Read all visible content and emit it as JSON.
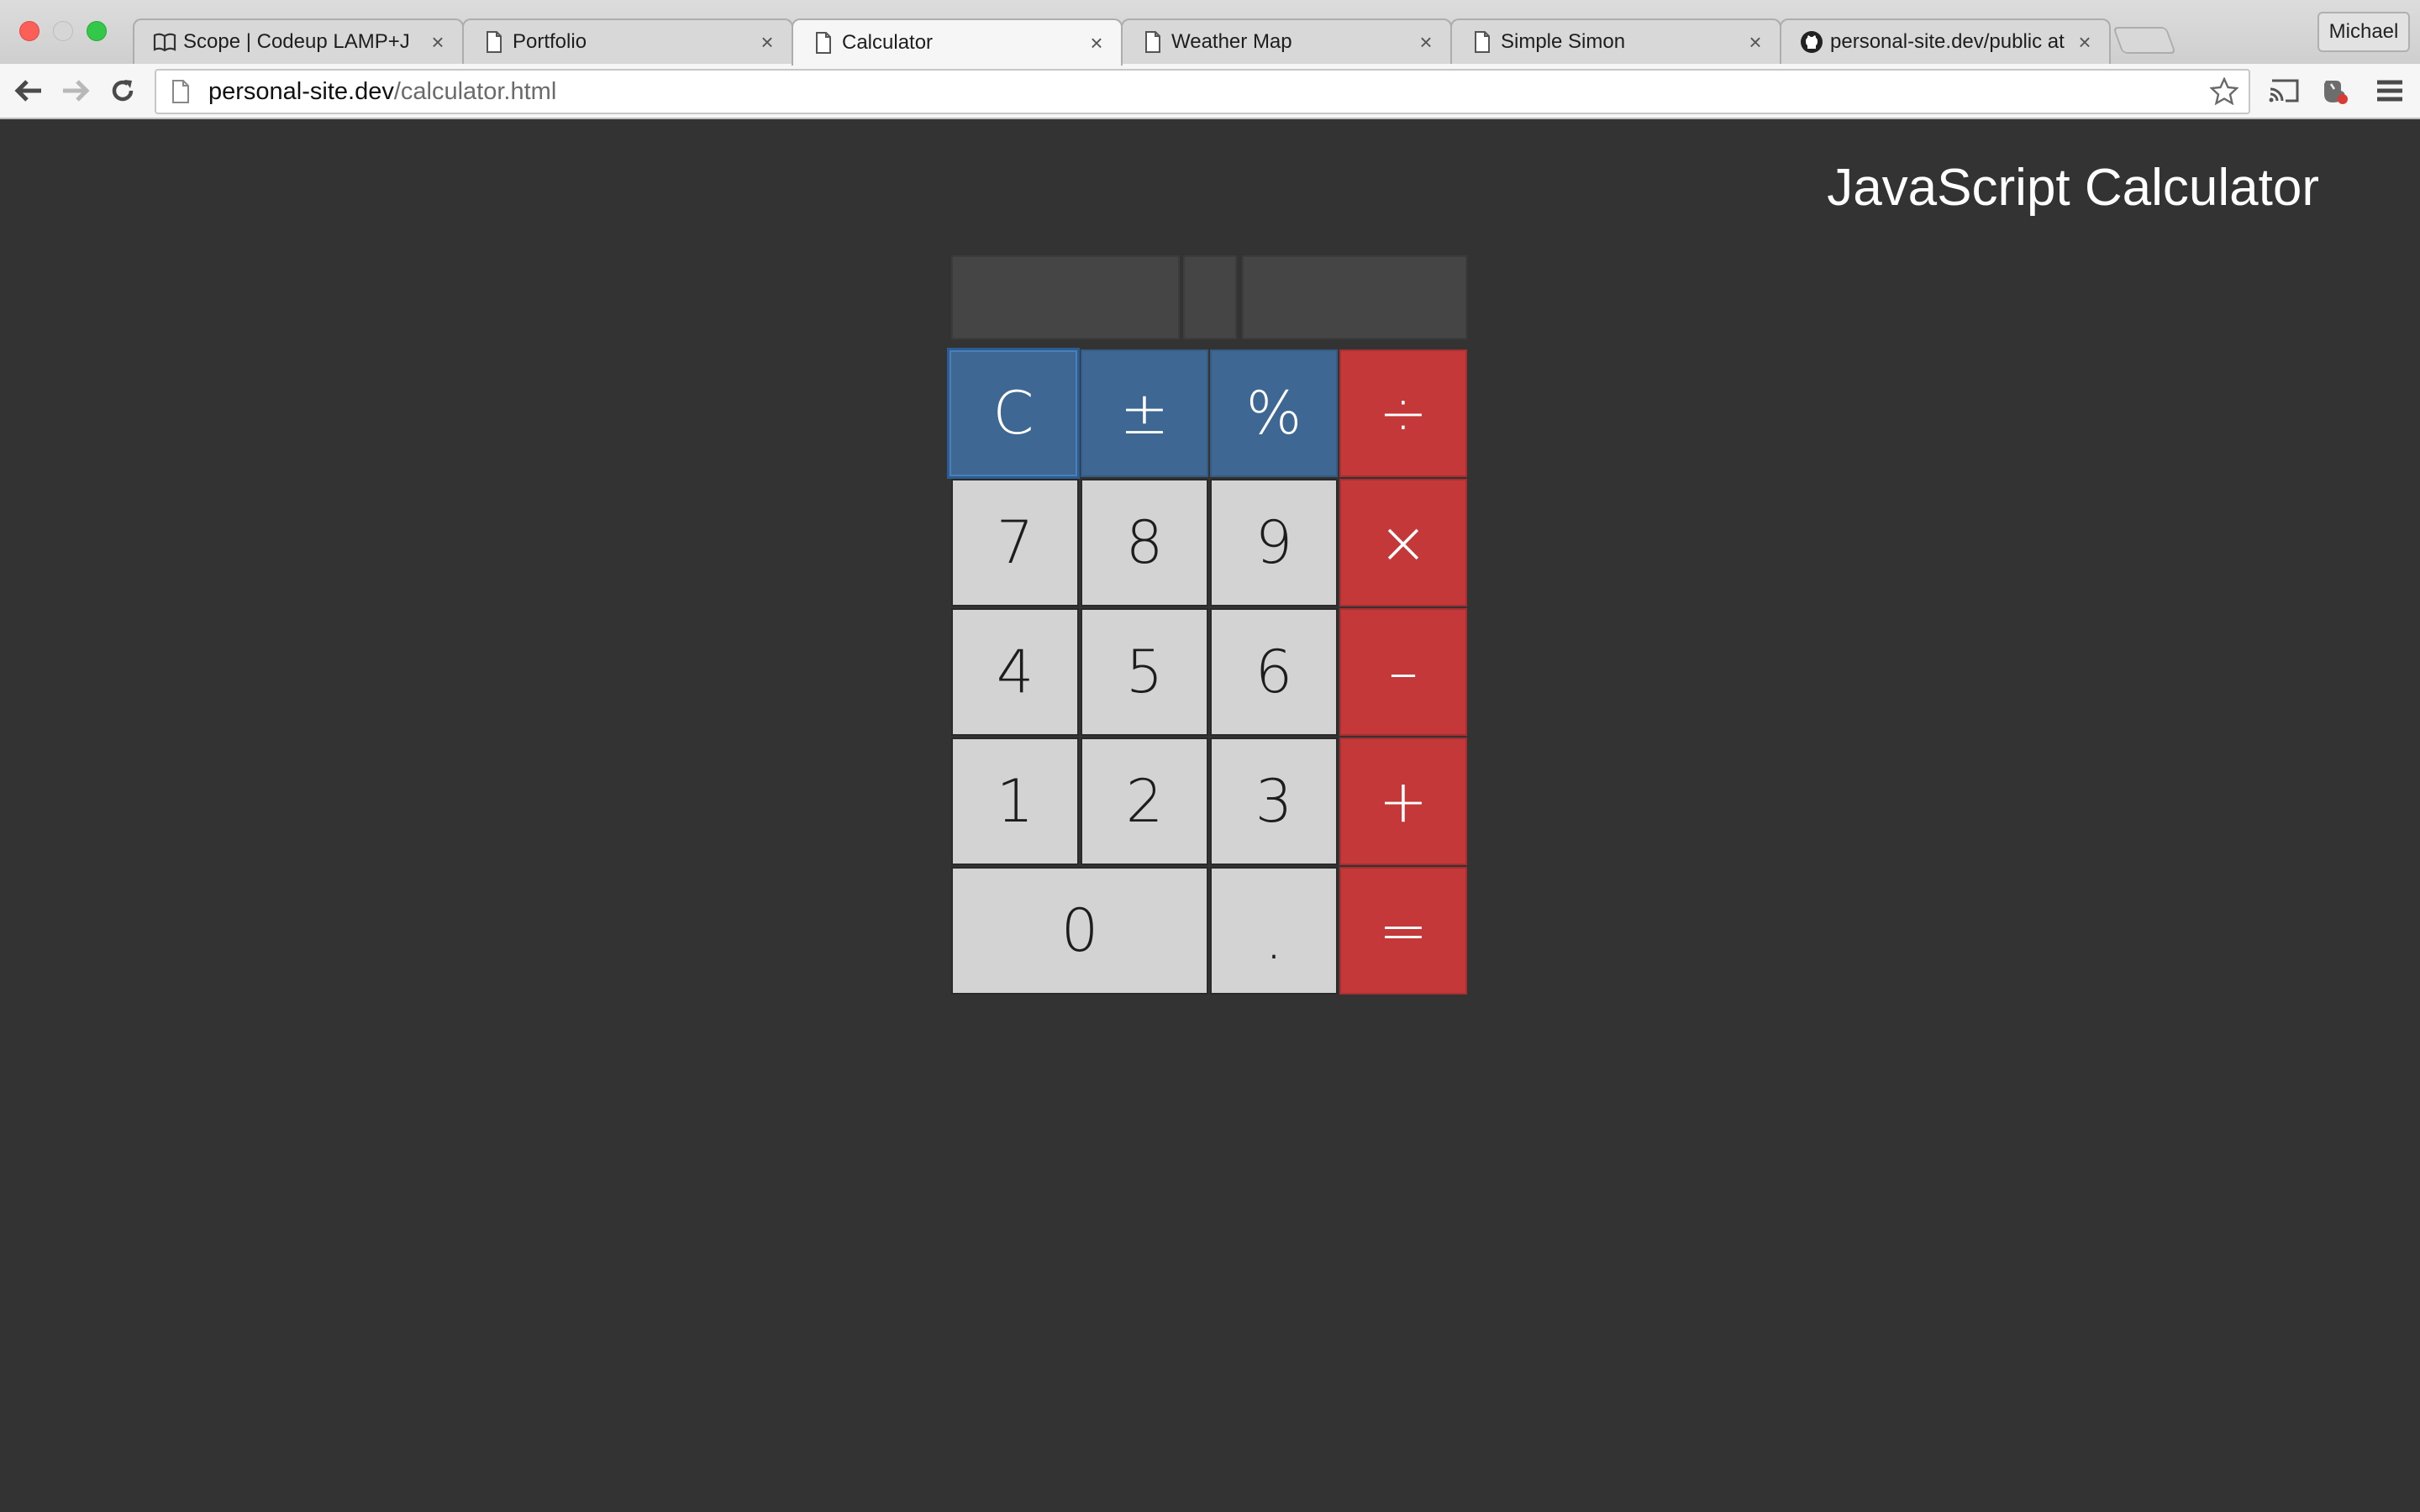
{
  "browser": {
    "tabs": [
      {
        "title": "Scope | Codeup LAMP+J",
        "icon": "book-icon",
        "active": false
      },
      {
        "title": "Portfolio",
        "icon": "page-icon",
        "active": false
      },
      {
        "title": "Calculator",
        "icon": "page-icon",
        "active": true
      },
      {
        "title": "Weather Map",
        "icon": "page-icon",
        "active": false
      },
      {
        "title": "Simple Simon",
        "icon": "page-icon",
        "active": false
      },
      {
        "title": "personal-site.dev/public at",
        "icon": "github-icon",
        "active": false
      }
    ],
    "tab_close_glyph": "×",
    "profile_name": "Michael",
    "url": {
      "host": "personal-site.dev",
      "path": "/calculator.html"
    }
  },
  "page": {
    "title": "JavaScript Calculator"
  },
  "calculator": {
    "display": {
      "left": "",
      "operator": "",
      "right": ""
    },
    "keys": {
      "clear": "C",
      "sign": "±",
      "percent": "%",
      "divide": "÷",
      "seven": "7",
      "eight": "8",
      "nine": "9",
      "multiply": "×",
      "four": "4",
      "five": "5",
      "six": "6",
      "subtract": "–",
      "one": "1",
      "two": "2",
      "three": "3",
      "add": "+",
      "zero": "0",
      "decimal": ".",
      "equals": "="
    },
    "colors": {
      "function": "#3e6794",
      "operator": "#c5383a",
      "number": "#d3d3d3",
      "background": "#333333"
    }
  }
}
